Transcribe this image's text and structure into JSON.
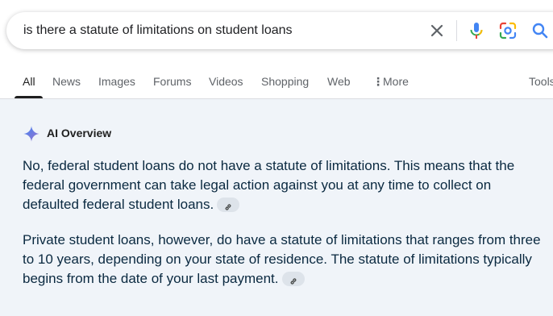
{
  "search": {
    "query": "is there a statute of limitations on student loans"
  },
  "tabs": [
    {
      "label": "All",
      "active": true
    },
    {
      "label": "News"
    },
    {
      "label": "Images"
    },
    {
      "label": "Forums"
    },
    {
      "label": "Videos"
    },
    {
      "label": "Shopping"
    },
    {
      "label": "Web"
    },
    {
      "label": "More"
    }
  ],
  "tools_label": "Tools",
  "ai_overview": {
    "title": "AI Overview",
    "paragraphs": [
      "No, federal student loans do not have a statute of limitations. This means that the federal government can take legal action against you at any time to collect on defaulted federal student loans.",
      "Private student loans, however, do have a statute of limitations that ranges from three to 10 years, depending on your state of residence. The statute of limitations typically begins from the date of your last payment."
    ]
  },
  "icons": {
    "clear": "close-icon",
    "mic": "microphone-icon",
    "lens": "lens-icon",
    "search": "search-icon",
    "sparkle": "sparkle-icon",
    "link": "link-icon",
    "more": "vertical-dots-icon"
  },
  "colors": {
    "panel_background": "#f0f4f9",
    "body_text": "#0a2940",
    "tab_text": "#5f6368",
    "active_tab": "#1f1f1f",
    "mic_blue": "#4285f4",
    "mic_red": "#ea4335",
    "search_blue": "#4285f4"
  }
}
